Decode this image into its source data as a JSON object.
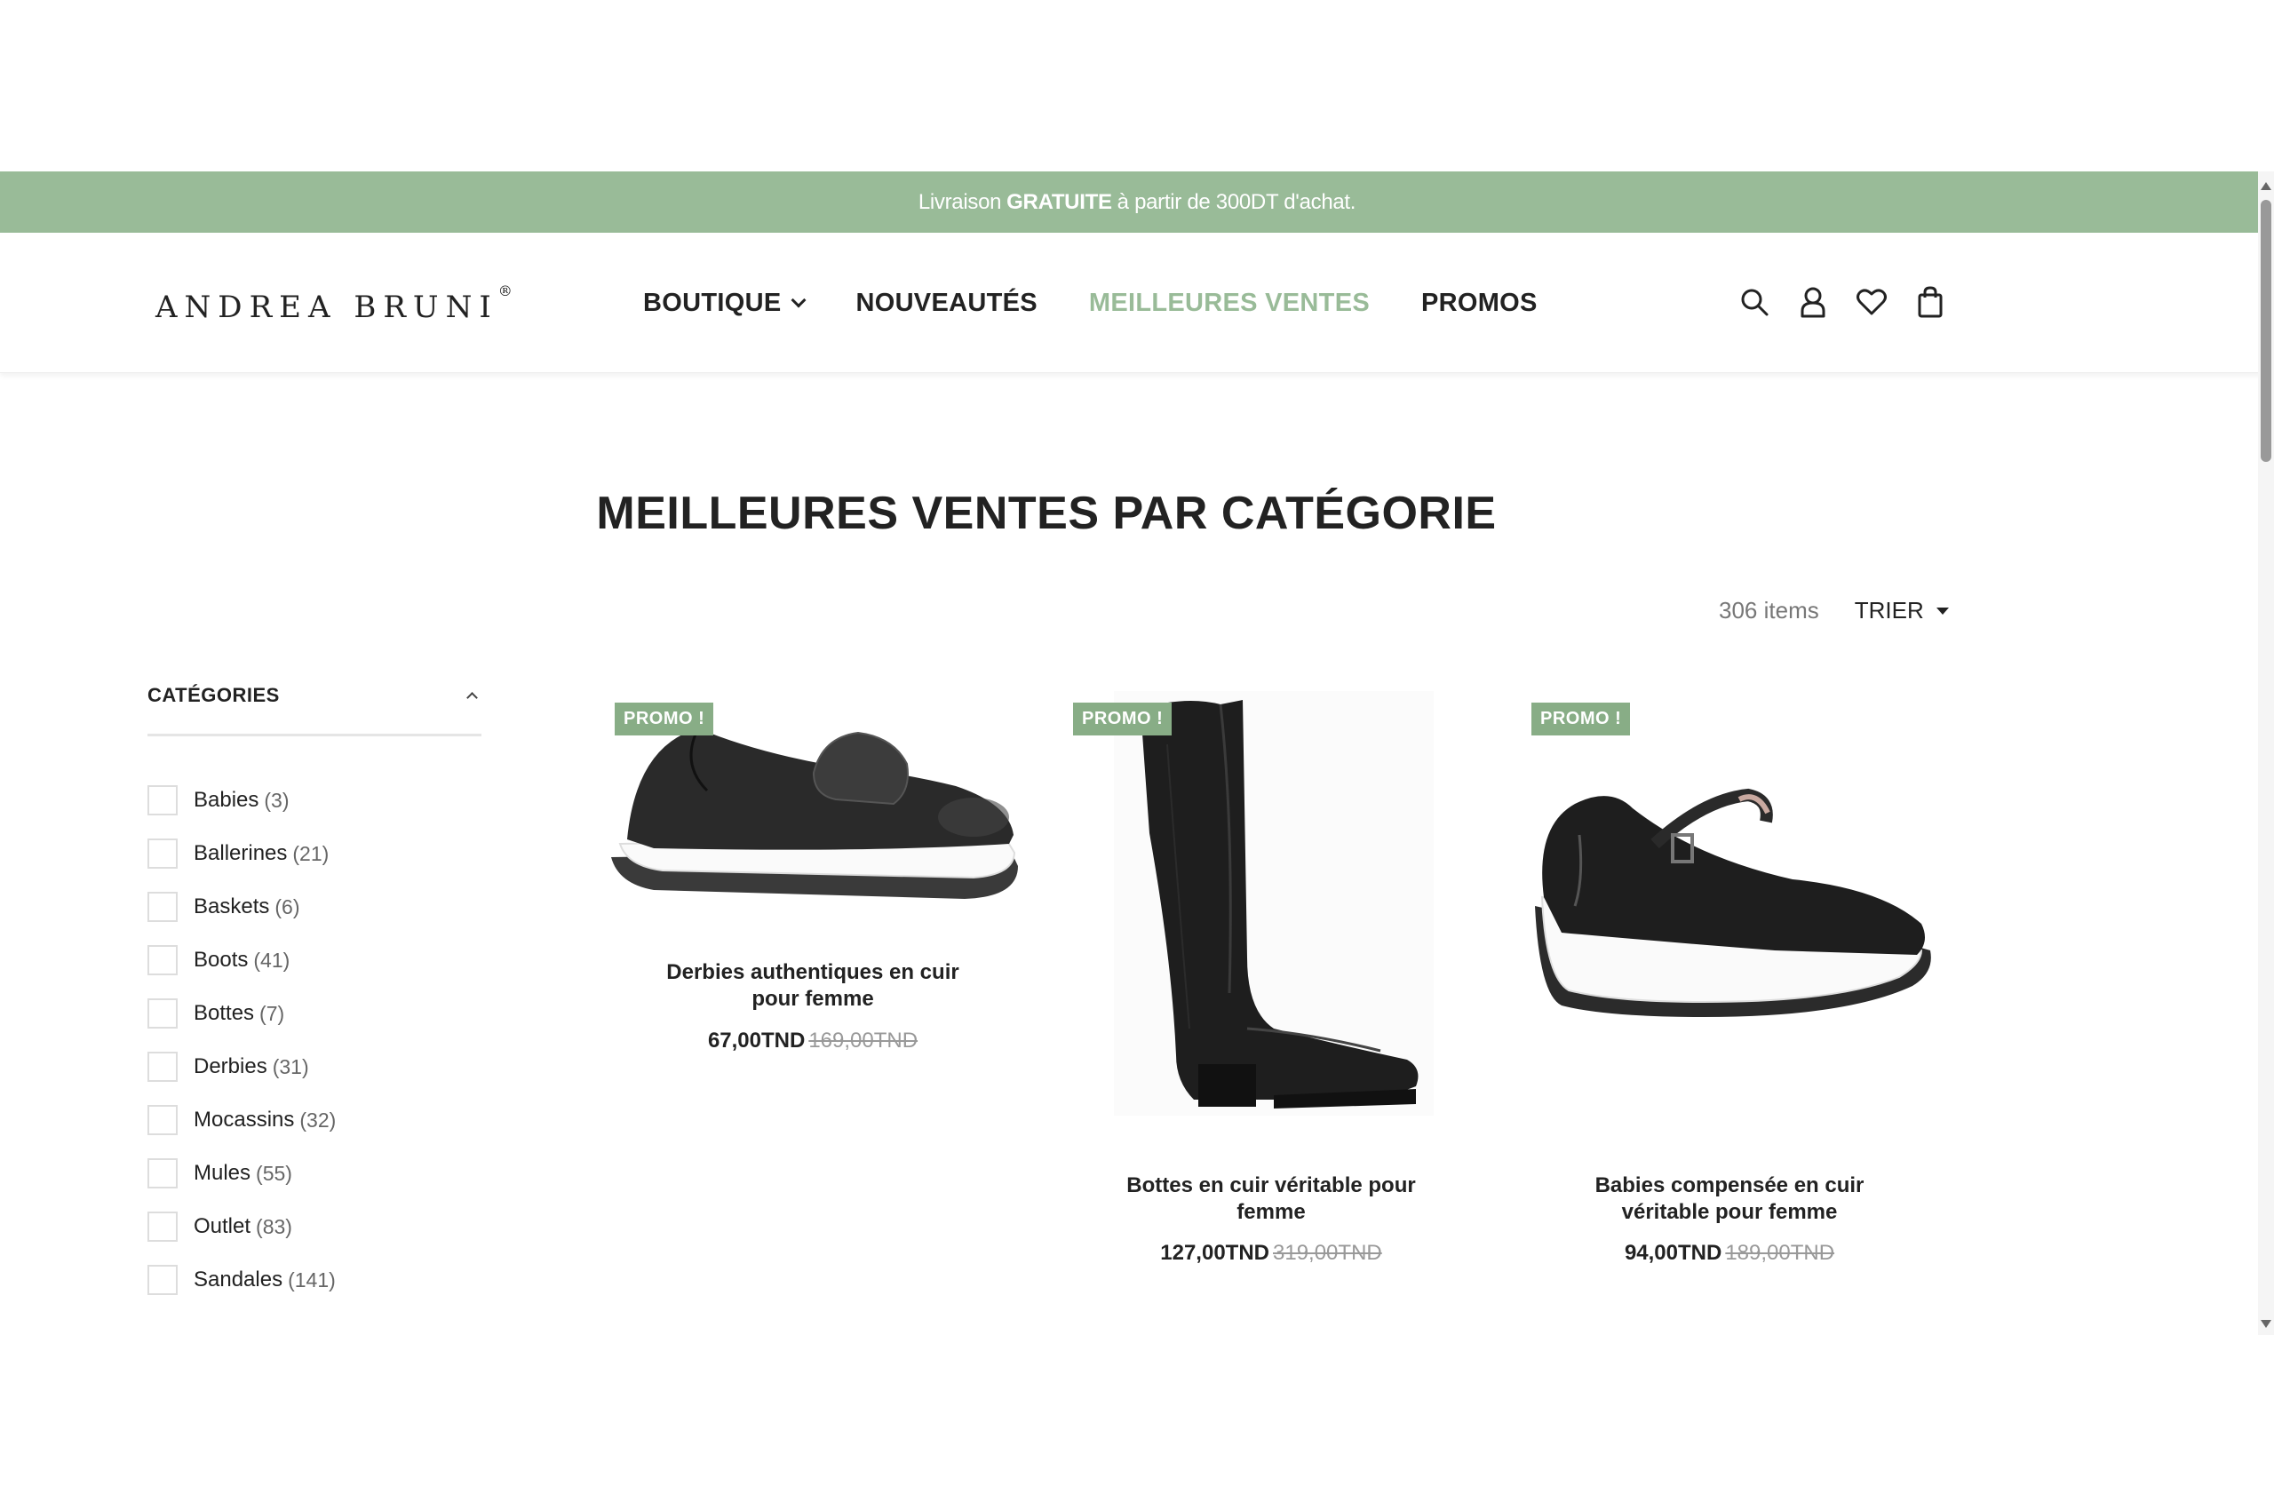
{
  "announcement": {
    "pre": "Livraison",
    "bold": "GRATUITE",
    "post": "à partir de 300DT d'achat."
  },
  "brand": {
    "name": "ANDREA BRUNI",
    "mark": "®"
  },
  "nav": [
    {
      "label": "BOUTIQUE",
      "has_dropdown": true,
      "active": false
    },
    {
      "label": "NOUVEAUTÉS",
      "has_dropdown": false,
      "active": false
    },
    {
      "label": "MEILLEURES VENTES",
      "has_dropdown": false,
      "active": true
    },
    {
      "label": "PROMOS",
      "has_dropdown": false,
      "active": false
    }
  ],
  "header_icons": [
    "search-icon",
    "account-icon",
    "wishlist-heart-icon",
    "cart-bag-icon"
  ],
  "page": {
    "title": "MEILLEURES VENTES PAR CATÉGORIE",
    "item_count": "306 items",
    "sort_label": "TRIER"
  },
  "sidebar": {
    "title": "CATÉGORIES",
    "categories": [
      {
        "name": "Babies",
        "count": "(3)"
      },
      {
        "name": "Ballerines",
        "count": "(21)"
      },
      {
        "name": "Baskets",
        "count": "(6)"
      },
      {
        "name": "Boots",
        "count": "(41)"
      },
      {
        "name": "Bottes",
        "count": "(7)"
      },
      {
        "name": "Derbies",
        "count": "(31)"
      },
      {
        "name": "Mocassins",
        "count": "(32)"
      },
      {
        "name": "Mules",
        "count": "(55)"
      },
      {
        "name": "Outlet",
        "count": "(83)"
      },
      {
        "name": "Sandales",
        "count": "(141)"
      }
    ]
  },
  "products": [
    {
      "badge": "PROMO !",
      "name_line1": "Derbies authentiques en cuir",
      "name_line2": "pour femme",
      "price": "67,00TND",
      "old_price": "169,00TND"
    },
    {
      "badge": "PROMO !",
      "name_line1": "Bottes en cuir véritable pour",
      "name_line2": "femme",
      "price": "127,00TND",
      "old_price": "319,00TND"
    },
    {
      "badge": "PROMO !",
      "name_line1": "Babies compensée en cuir",
      "name_line2": "véritable pour femme",
      "price": "94,00TND",
      "old_price": "189,00TND"
    }
  ],
  "colors": {
    "accent_green": "#99bb98",
    "badge_green": "#88ad86",
    "text_dark": "#222222"
  }
}
